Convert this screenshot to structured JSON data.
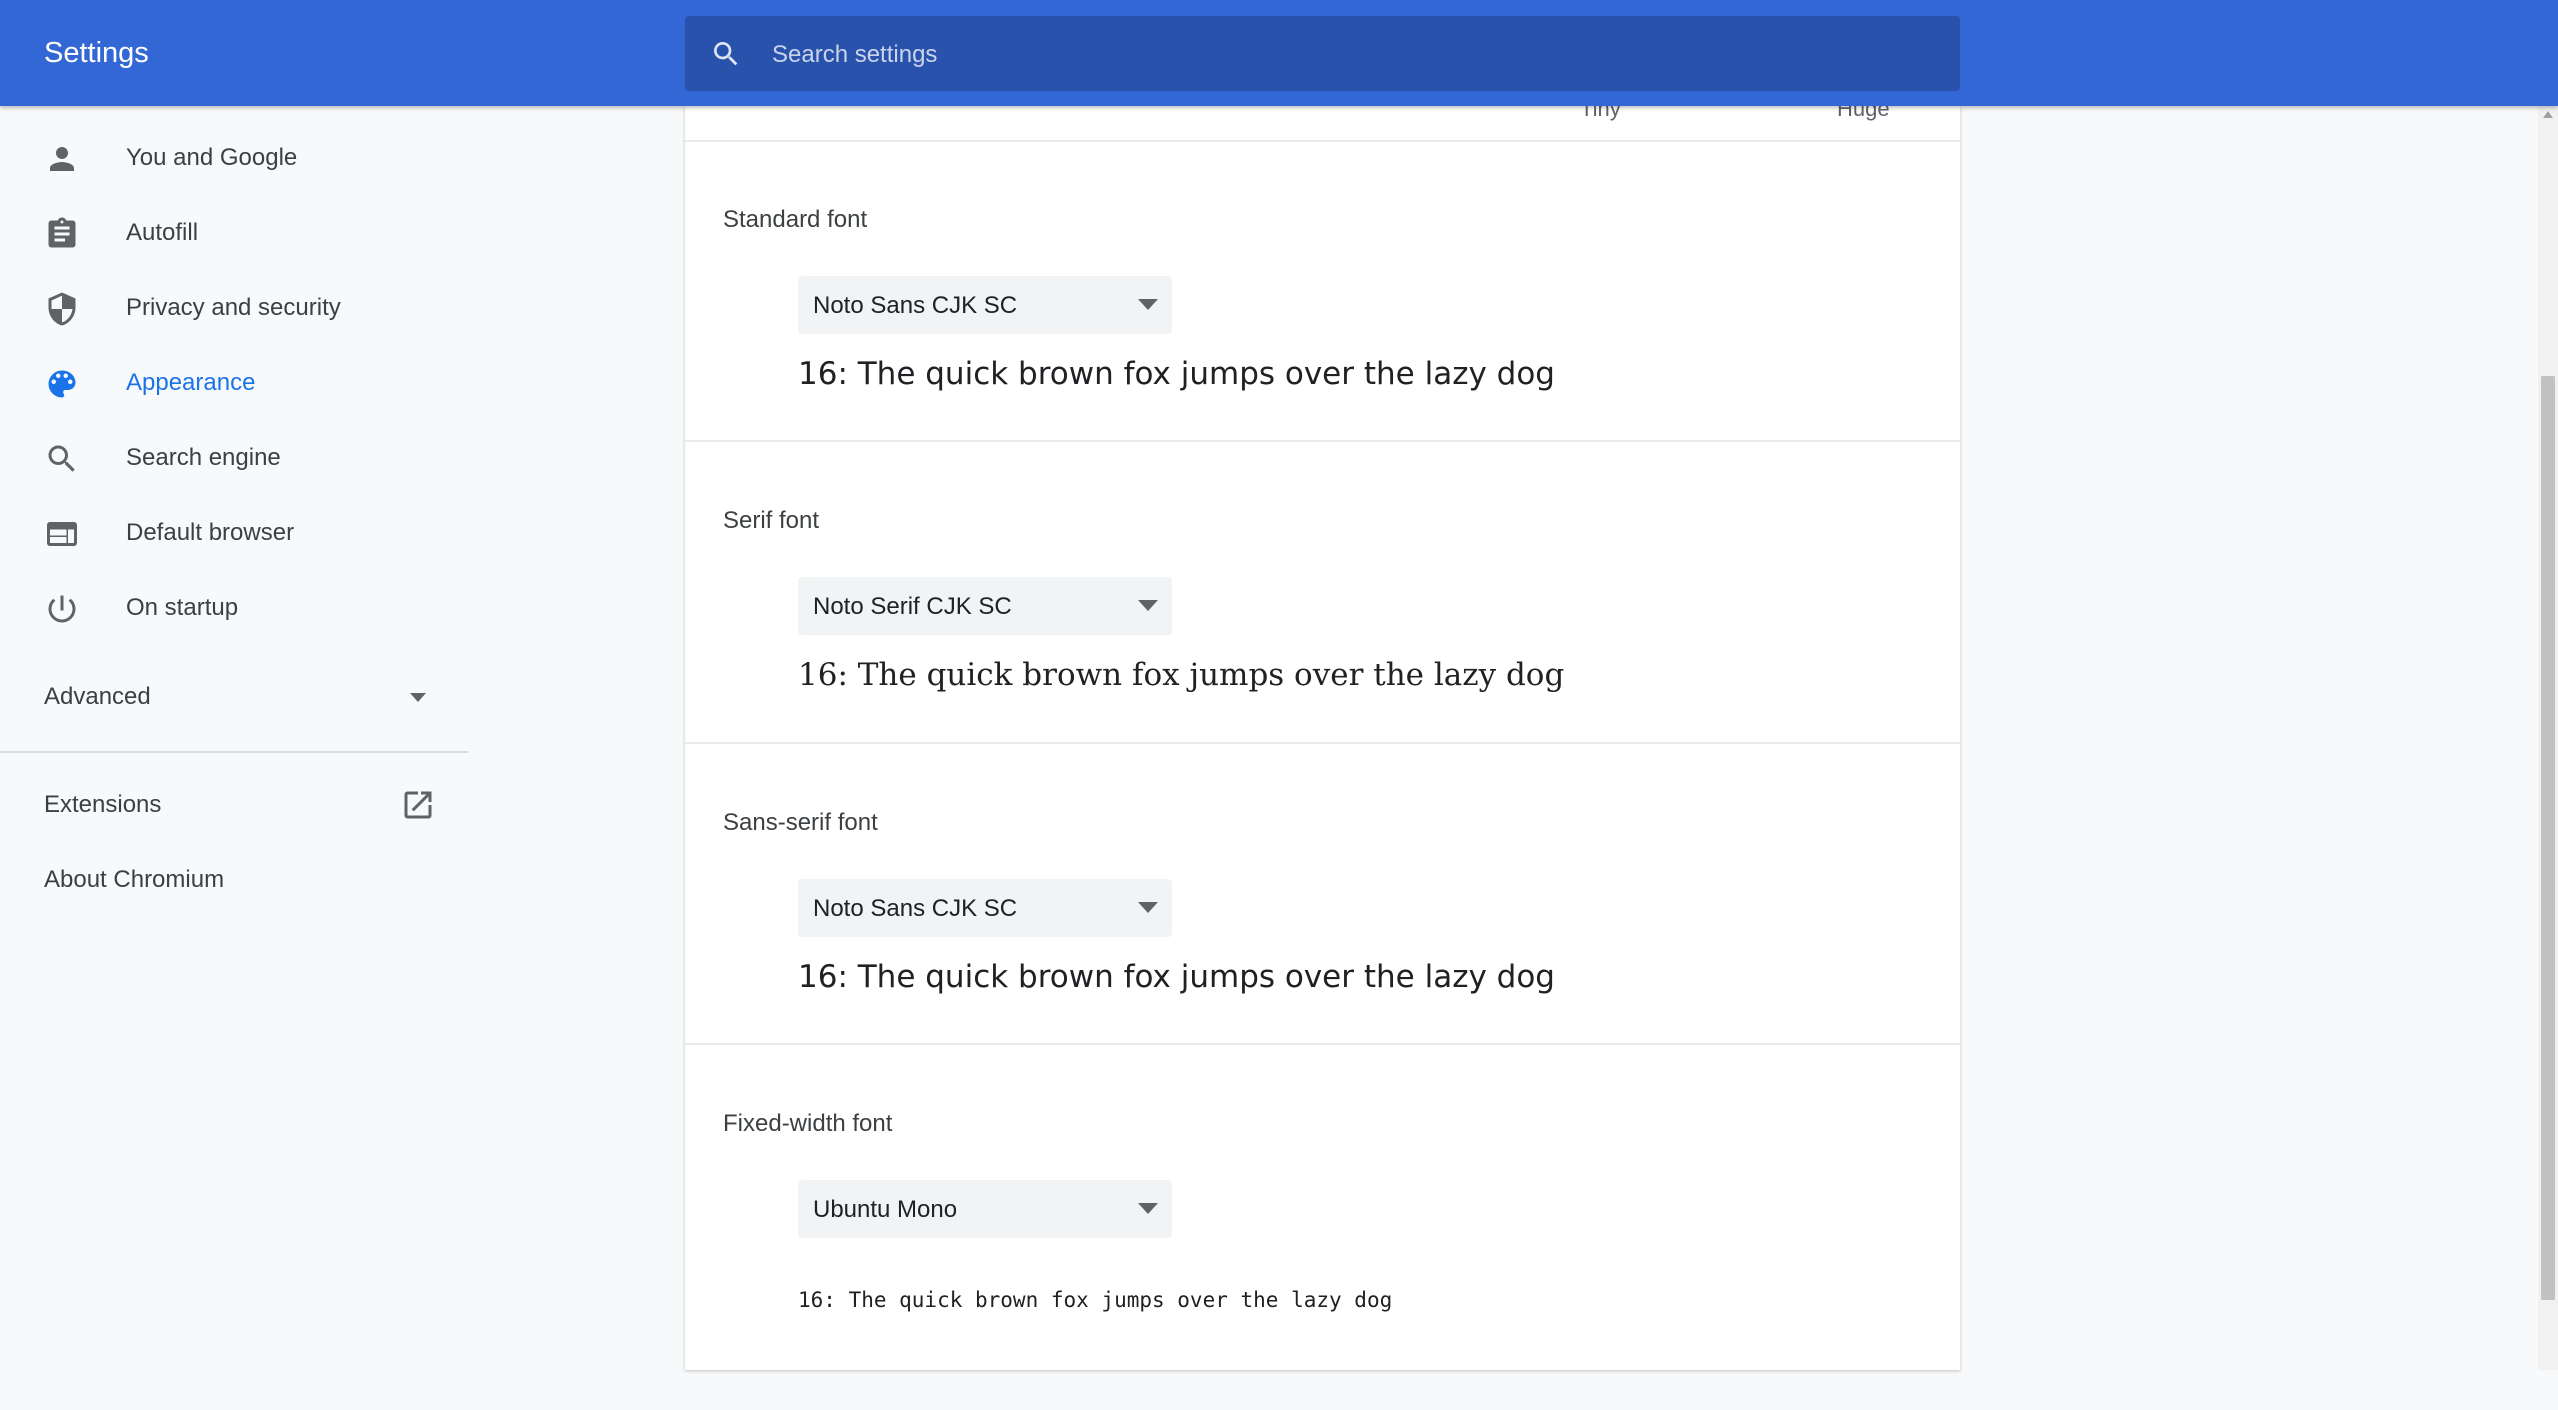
{
  "header": {
    "title": "Settings",
    "search_placeholder": "Search settings",
    "search_value": ""
  },
  "sidebar": {
    "items": [
      {
        "label": "You and Google",
        "icon": "person-icon",
        "active": false
      },
      {
        "label": "Autofill",
        "icon": "clipboard-icon",
        "active": false
      },
      {
        "label": "Privacy and security",
        "icon": "shield-icon",
        "active": false
      },
      {
        "label": "Appearance",
        "icon": "palette-icon",
        "active": true
      },
      {
        "label": "Search engine",
        "icon": "search-icon",
        "active": false
      },
      {
        "label": "Default browser",
        "icon": "browser-window-icon",
        "active": false
      },
      {
        "label": "On startup",
        "icon": "power-icon",
        "active": false
      }
    ],
    "advanced_label": "Advanced",
    "extensions_label": "Extensions",
    "about_label": "About Chromium"
  },
  "main": {
    "font_size_slider": {
      "min_label": "Tiny",
      "max_label": "Huge"
    },
    "sections": [
      {
        "title": "Standard font",
        "selected": "Noto Sans CJK SC",
        "sample": "16: The quick brown fox jumps over the lazy dog"
      },
      {
        "title": "Serif font",
        "selected": "Noto Serif CJK SC",
        "sample": "16: The quick brown fox jumps over the lazy dog"
      },
      {
        "title": "Sans-serif font",
        "selected": "Noto Sans CJK SC",
        "sample": "16: The quick brown fox jumps over the lazy dog"
      },
      {
        "title": "Fixed-width font",
        "selected": "Ubuntu Mono",
        "sample": "16: The quick brown fox jumps over the lazy dog"
      }
    ]
  },
  "colors": {
    "header_bg": "#3367d6",
    "search_bg": "#2852ac",
    "active_accent": "#1a73e8",
    "sidebar_bg": "#f8f9fa"
  }
}
